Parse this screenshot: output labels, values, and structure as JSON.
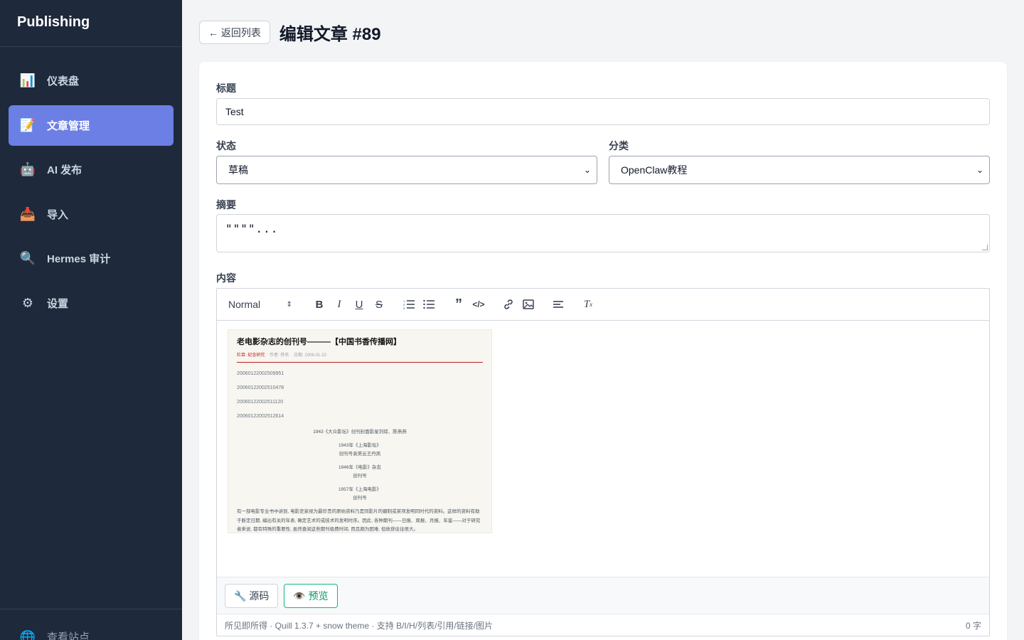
{
  "sidebar": {
    "brand": "Publishing",
    "items": [
      {
        "label": "仪表盘",
        "icon": "📊"
      },
      {
        "label": "文章管理",
        "icon": "📝"
      },
      {
        "label": "AI 发布",
        "icon": "🤖"
      },
      {
        "label": "导入",
        "icon": "📥"
      },
      {
        "label": "Hermes 审计",
        "icon": "🔍"
      },
      {
        "label": "设置",
        "icon": "⚙"
      }
    ],
    "footer": {
      "label": "查看站点",
      "icon": "🌐"
    }
  },
  "header": {
    "back_label": "← 返回列表",
    "title": "编辑文章 #89"
  },
  "form": {
    "title_label": "标题",
    "title_value": "Test",
    "status_label": "状态",
    "status_value": "草稿",
    "category_label": "分类",
    "category_value": "OpenClaw教程",
    "summary_label": "摘要",
    "summary_value": "\"\"\"\"...",
    "content_label": "内容"
  },
  "editor": {
    "format_value": "Normal",
    "embedded_doc": {
      "title": "老电影杂志的创刊号———【中国书香传播网】",
      "meta_column": "栏目: 纪念研究",
      "meta_author": "作者: 佚名",
      "meta_date": "日期: 2006-01-22",
      "images": [
        "20060122002509951",
        "20060122002510478",
        "20060122002511120",
        "20060122002512614"
      ],
      "caption1": "1943《大众影坛》创刊封面影星刘琼、陈燕燕",
      "caption2a": "1943年《上海影坛》",
      "caption2b": "创刊号袁美云王丹凤",
      "caption3a": "1946年《电影》杂志",
      "caption3b": "创刊号",
      "caption4a": "1957年《上海电影》",
      "caption4b": "创刊号",
      "para": "有一部电影专业书中讲到, 电影史家视为最珍贵的原始资料乃是同影片的摄制或某项发明同时代的资料。这样的资料有助于断定日期, 编出有关的年表, 确定艺术的或技术的发明时序。因此, 各种期刊——日报、周报、月报、年鉴——对于研究者来说, 都有特殊的重要性, 虽然查阅这些期刊极费时间, 而且颇为困难, 但收获往往很大。"
    },
    "source_btn": "🔧 源码",
    "preview_btn": "👁️ 预览",
    "status_left": "所见即所得 · Quill 1.3.7 + snow theme · 支持 B/I/H/列表/引用/链接/图片",
    "status_right": "0 字"
  }
}
